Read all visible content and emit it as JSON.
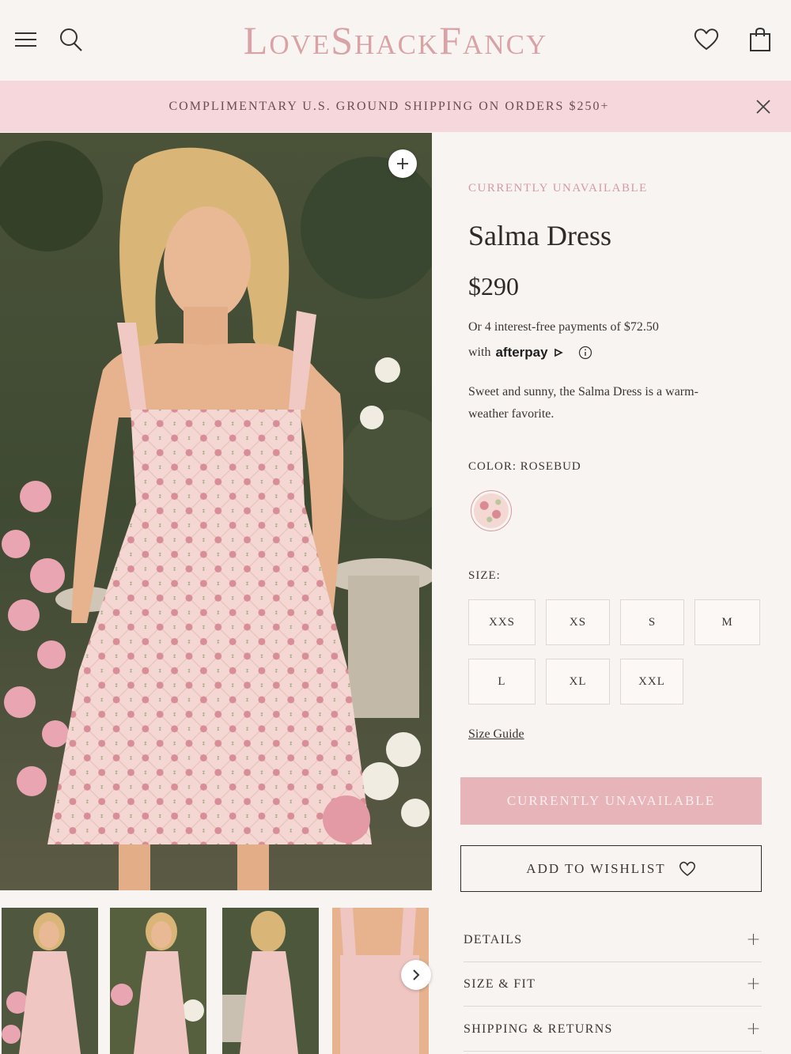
{
  "header": {
    "logo": "LoveShackFancy",
    "menu_icon": "hamburger-icon",
    "search_icon": "search-icon",
    "wishlist_icon": "heart-icon",
    "bag_icon": "shopping-bag-icon"
  },
  "banner": {
    "text": "COMPLIMENTARY U.S. GROUND SHIPPING ON ORDERS $250+",
    "close_icon": "close-icon"
  },
  "product": {
    "status": "CURRENTLY UNAVAILABLE",
    "title": "Salma Dress",
    "price": "$290",
    "afterpay_text": "Or 4 interest-free payments of $72.50",
    "afterpay_with": "with",
    "afterpay_logo": "afterpay",
    "description": "Sweet and sunny, the Salma Dress is a warm-weather favorite.",
    "color_label": "COLOR: ROSEBUD",
    "size_label": "SIZE:",
    "sizes": [
      "XXS",
      "XS",
      "S",
      "M",
      "L",
      "XL",
      "XXL"
    ],
    "size_guide": "Size Guide",
    "unavailable_button": "CURRENTLY UNAVAILABLE",
    "wishlist_button": "ADD TO WISHLIST"
  },
  "accordion": [
    {
      "label": "DETAILS"
    },
    {
      "label": "SIZE & FIT"
    },
    {
      "label": "SHIPPING & RETURNS"
    }
  ],
  "colors": {
    "accent_pink": "#d49ba1",
    "banner_bg": "#f5d7dc",
    "button_unavailable": "#e7b4ba",
    "logo": "#d9a3a6"
  }
}
